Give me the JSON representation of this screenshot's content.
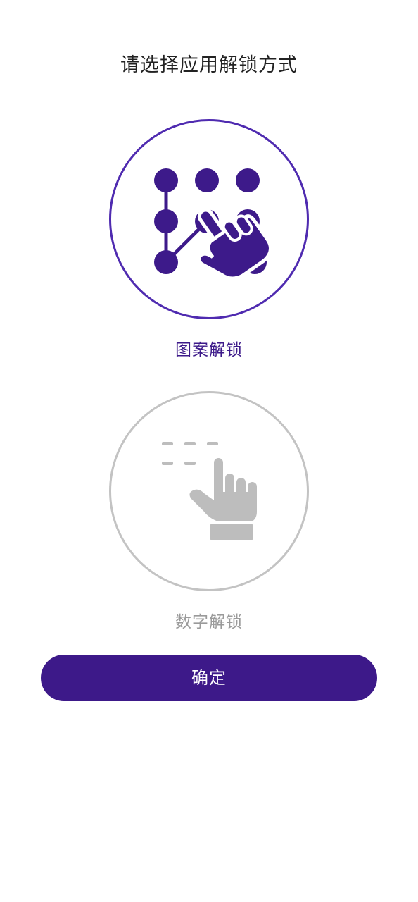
{
  "header": {
    "title": "请选择应用解锁方式"
  },
  "options": [
    {
      "label": "图案解锁",
      "icon": "pattern-unlock-icon",
      "selected": true,
      "color": "#3d1a8a"
    },
    {
      "label": "数字解锁",
      "icon": "number-unlock-icon",
      "selected": false,
      "color": "#bdbdbd"
    }
  ],
  "footer": {
    "confirm_label": "确定",
    "button_color": "#3d1989"
  }
}
